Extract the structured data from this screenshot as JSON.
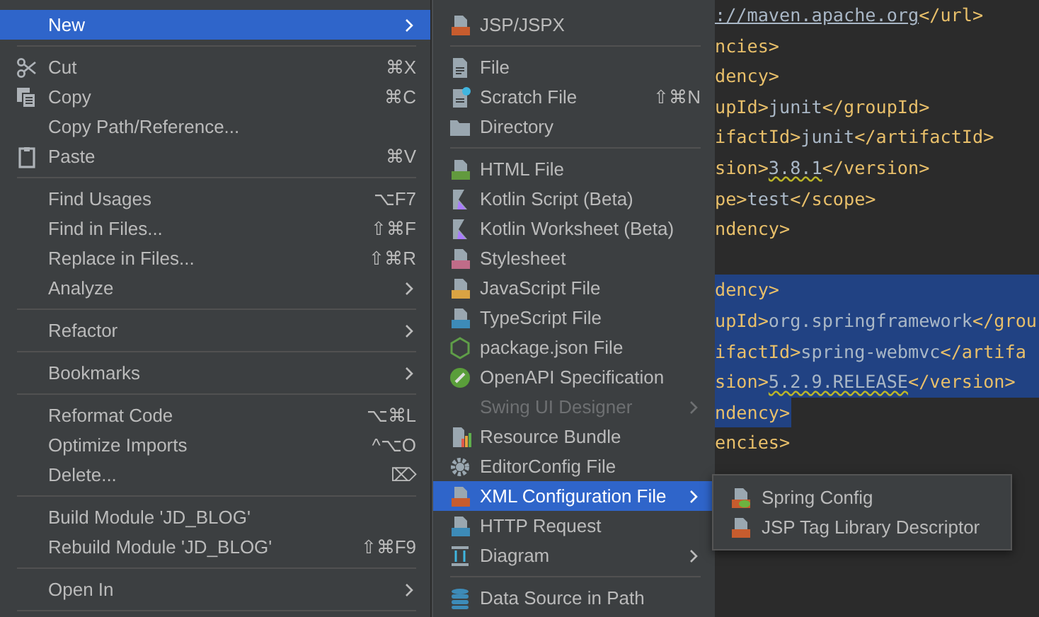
{
  "editor": {
    "lines": [
      {
        "selected": false,
        "parts": [
          {
            "kind": "link",
            "text": "://maven.apache.org"
          },
          {
            "kind": "tag",
            "text": "</url>"
          }
        ]
      },
      {
        "selected": false,
        "parts": [
          {
            "kind": "tag",
            "text": "ncies>"
          }
        ]
      },
      {
        "selected": false,
        "parts": [
          {
            "kind": "tag",
            "text": "dency>"
          }
        ]
      },
      {
        "selected": false,
        "parts": [
          {
            "kind": "tag",
            "text": "upId>"
          },
          {
            "kind": "value",
            "text": "junit"
          },
          {
            "kind": "tag",
            "text": "</groupId>"
          }
        ]
      },
      {
        "selected": false,
        "parts": [
          {
            "kind": "tag",
            "text": "ifactId>"
          },
          {
            "kind": "value",
            "text": "junit"
          },
          {
            "kind": "tag",
            "text": "</artifactId>"
          }
        ]
      },
      {
        "selected": false,
        "parts": [
          {
            "kind": "tag",
            "text": "sion>"
          },
          {
            "kind": "warn",
            "text": "3.8.1"
          },
          {
            "kind": "tag",
            "text": "</version>"
          }
        ]
      },
      {
        "selected": false,
        "parts": [
          {
            "kind": "tag",
            "text": "pe>"
          },
          {
            "kind": "value",
            "text": "test"
          },
          {
            "kind": "tag",
            "text": "</scope>"
          }
        ]
      },
      {
        "selected": false,
        "parts": [
          {
            "kind": "tag",
            "text": "ndency>"
          }
        ]
      },
      {
        "selected": false
      },
      {
        "selected": true,
        "parts": [
          {
            "kind": "tag",
            "text": "dency>"
          }
        ]
      },
      {
        "selected": true,
        "parts": [
          {
            "kind": "tag",
            "text": "upId>"
          },
          {
            "kind": "value",
            "text": "org.springframework"
          },
          {
            "kind": "tag",
            "text": "</grou"
          }
        ]
      },
      {
        "selected": true,
        "parts": [
          {
            "kind": "tag",
            "text": "ifactId>"
          },
          {
            "kind": "value",
            "text": "spring-webmvc"
          },
          {
            "kind": "tag",
            "text": "</artifa"
          }
        ]
      },
      {
        "selected": true,
        "parts": [
          {
            "kind": "tag",
            "text": "sion>"
          },
          {
            "kind": "warn",
            "text": "5.2.9.RELEASE"
          },
          {
            "kind": "tag",
            "text": "</version>"
          }
        ]
      },
      {
        "selected": true,
        "parts": [
          {
            "kind": "tag",
            "text": "ndency>"
          }
        ]
      },
      {
        "selected": false,
        "parts": [
          {
            "kind": "tag",
            "text": "encies>"
          }
        ]
      }
    ]
  },
  "context_menu": {
    "items": [
      {
        "kind": "item",
        "label": "New",
        "selected": true,
        "submenu": true
      },
      {
        "kind": "separator"
      },
      {
        "kind": "item",
        "label": "Cut",
        "shortcut": "⌘X",
        "selected": false
      },
      {
        "kind": "item",
        "label": "Copy",
        "shortcut": "⌘C",
        "selected": false
      },
      {
        "kind": "item",
        "label": "Copy Path/Reference...",
        "selected": false
      },
      {
        "kind": "item",
        "label": "Paste",
        "shortcut": "⌘V",
        "selected": false
      },
      {
        "kind": "separator"
      },
      {
        "kind": "item",
        "label": "Find Usages",
        "shortcut": "⌥F7",
        "selected": false
      },
      {
        "kind": "item",
        "label": "Find in Files...",
        "shortcut": "⇧⌘F",
        "selected": false
      },
      {
        "kind": "item",
        "label": "Replace in Files...",
        "shortcut": "⇧⌘R",
        "selected": false
      },
      {
        "kind": "item",
        "label": "Analyze",
        "submenu": true,
        "selected": false
      },
      {
        "kind": "separator"
      },
      {
        "kind": "item",
        "label": "Refactor",
        "submenu": true,
        "selected": false
      },
      {
        "kind": "separator"
      },
      {
        "kind": "item",
        "label": "Bookmarks",
        "submenu": true,
        "selected": false
      },
      {
        "kind": "separator"
      },
      {
        "kind": "item",
        "label": "Reformat Code",
        "shortcut": "⌥⌘L",
        "selected": false
      },
      {
        "kind": "item",
        "label": "Optimize Imports",
        "shortcut": "^⌥O",
        "selected": false
      },
      {
        "kind": "item",
        "label": "Delete...",
        "shortcut": "⌦",
        "selected": false
      },
      {
        "kind": "separator"
      },
      {
        "kind": "item",
        "label": "Build Module 'JD_BLOG'",
        "selected": false
      },
      {
        "kind": "item",
        "label": "Rebuild Module 'JD_BLOG'",
        "shortcut": "⇧⌘F9",
        "selected": false
      },
      {
        "kind": "separator"
      },
      {
        "kind": "item",
        "label": "Open In",
        "submenu": true,
        "selected": false
      },
      {
        "kind": "separator"
      }
    ]
  },
  "new_submenu": {
    "items": [
      {
        "kind": "item",
        "label": "JSP/JSPX",
        "selected": false
      },
      {
        "kind": "separator"
      },
      {
        "kind": "item",
        "label": "File",
        "selected": false
      },
      {
        "kind": "item",
        "label": "Scratch File",
        "shortcut": "⇧⌘N",
        "selected": false
      },
      {
        "kind": "item",
        "label": "Directory",
        "selected": false
      },
      {
        "kind": "separator"
      },
      {
        "kind": "item",
        "label": "HTML File",
        "selected": false
      },
      {
        "kind": "item",
        "label": "Kotlin Script (Beta)",
        "selected": false
      },
      {
        "kind": "item",
        "label": "Kotlin Worksheet (Beta)",
        "selected": false
      },
      {
        "kind": "item",
        "label": "Stylesheet",
        "selected": false
      },
      {
        "kind": "item",
        "label": "JavaScript File",
        "selected": false
      },
      {
        "kind": "item",
        "label": "TypeScript File",
        "selected": false
      },
      {
        "kind": "item",
        "label": "package.json File",
        "selected": false
      },
      {
        "kind": "item",
        "label": "OpenAPI Specification",
        "selected": false
      },
      {
        "kind": "item",
        "label": "Swing UI Designer",
        "submenu": true,
        "disabled": true,
        "selected": false
      },
      {
        "kind": "item",
        "label": "Resource Bundle",
        "selected": false
      },
      {
        "kind": "item",
        "label": "EditorConfig File",
        "selected": false
      },
      {
        "kind": "item",
        "label": "XML Configuration File",
        "submenu": true,
        "selected": true
      },
      {
        "kind": "item",
        "label": "HTTP Request",
        "selected": false
      },
      {
        "kind": "item",
        "label": "Diagram",
        "submenu": true,
        "selected": false
      },
      {
        "kind": "separator"
      },
      {
        "kind": "item",
        "label": "Data Source in Path",
        "selected": false
      }
    ]
  },
  "xml_submenu": {
    "items": [
      {
        "kind": "item",
        "label": "Spring Config",
        "selected": false
      },
      {
        "kind": "item",
        "label": "JSP Tag Library Descriptor",
        "selected": false
      }
    ]
  }
}
